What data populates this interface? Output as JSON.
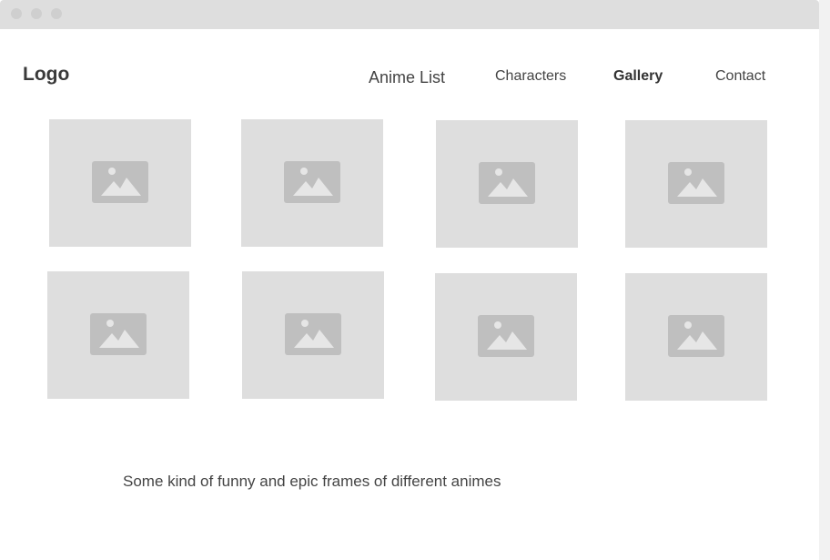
{
  "header": {
    "logo": "Logo"
  },
  "nav": {
    "items": [
      {
        "label": "Anime List"
      },
      {
        "label": "Characters"
      },
      {
        "label": "Gallery",
        "active": true
      },
      {
        "label": "Contact"
      }
    ]
  },
  "gallery": {
    "icon": "image-placeholder-icon",
    "count": 8
  },
  "caption": "Some kind of funny and epic frames of different animes",
  "colors": {
    "titlebar": "#dedede",
    "placeholder_bg": "#dedede",
    "placeholder_icon": "#bfbfbf",
    "text": "#444444"
  }
}
